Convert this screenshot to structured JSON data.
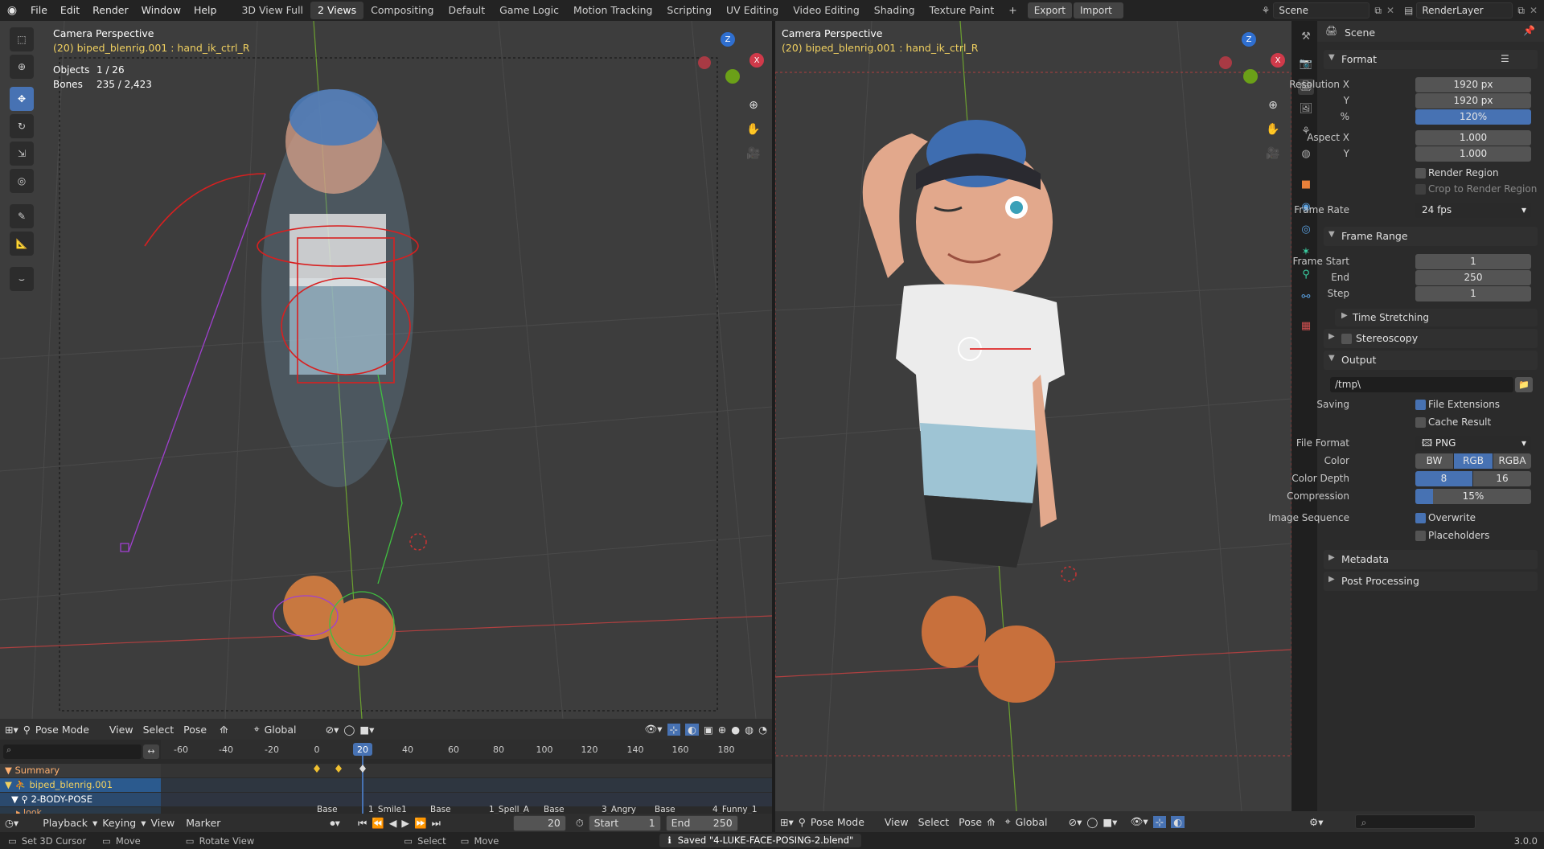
{
  "app": {
    "logo": "blender-logo-icon"
  },
  "menu": {
    "items": [
      "File",
      "Edit",
      "Render",
      "Window",
      "Help"
    ]
  },
  "workspaces": {
    "tabs": [
      "3D View Full",
      "2 Views",
      "Compositing",
      "Default",
      "Game Logic",
      "Motion Tracking",
      "Scripting",
      "UV Editing",
      "Video Editing",
      "Shading",
      "Texture Paint"
    ],
    "active": "2 Views",
    "add": "+"
  },
  "export_btn": "Export",
  "import_btn": "Import",
  "scene": {
    "name": "Scene",
    "view_layer": "RenderLayer"
  },
  "left_viewport": {
    "title": "Camera Perspective",
    "subtitle": "(20) biped_blenrig.001 : hand_ik_ctrl_R",
    "stats_objects_label": "Objects",
    "stats_objects_value": "1 / 26",
    "stats_bones_label": "Bones",
    "stats_bones_value": "235 / 2,423"
  },
  "right_viewport": {
    "title": "Camera Perspective",
    "subtitle": "(20) biped_blenrig.001 : hand_ik_ctrl_R"
  },
  "viewport_header": {
    "mode": "Pose Mode",
    "view": "View",
    "select": "Select",
    "pose": "Pose",
    "orientation": "Global"
  },
  "timeline": {
    "ruler": [
      "-60",
      "-40",
      "-20",
      "0",
      "20",
      "40",
      "60",
      "80",
      "100",
      "120",
      "140",
      "160",
      "180"
    ],
    "current_frame": "20",
    "channels": [
      "Summary",
      "biped_blenrig.001",
      "2-BODY-POSE",
      "look"
    ],
    "markers": [
      "Base",
      "1_Smile1",
      "Base",
      "1_Spell_A",
      "Base",
      "3_Angry",
      "Base",
      "4_Funny_1"
    ],
    "playback": "Playback",
    "keying": "Keying",
    "view": "View",
    "marker": "Marker",
    "frame_field": "20",
    "start_label": "Start",
    "start_value": "1",
    "end_label": "End",
    "end_value": "250"
  },
  "properties": {
    "header": "Scene",
    "sections": {
      "format": "Format",
      "frame_range": "Frame Range",
      "time_stretching": "Time Stretching",
      "stereoscopy": "Stereoscopy",
      "output": "Output",
      "metadata": "Metadata",
      "post_processing": "Post Processing"
    },
    "resolution_x_label": "Resolution X",
    "resolution_x": "1920 px",
    "resolution_y_label": "Y",
    "resolution_y": "1920 px",
    "percent_label": "%",
    "percent": "120%",
    "aspect_x_label": "Aspect X",
    "aspect_x": "1.000",
    "aspect_y_label": "Y",
    "aspect_y": "1.000",
    "render_region": "Render Region",
    "crop_region": "Crop to Render Region",
    "frame_rate_label": "Frame Rate",
    "frame_rate": "24 fps",
    "frame_start_label": "Frame Start",
    "frame_start": "1",
    "end_label": "End",
    "end": "250",
    "step_label": "Step",
    "step": "1",
    "output_path": "/tmp\\",
    "saving_label": "Saving",
    "file_extensions": "File Extensions",
    "cache_result": "Cache Result",
    "file_format_label": "File Format",
    "file_format": "PNG",
    "color_label": "Color",
    "color_bw": "BW",
    "color_rgb": "RGB",
    "color_rgba": "RGBA",
    "color_depth_label": "Color Depth",
    "depth_8": "8",
    "depth_16": "16",
    "compression_label": "Compression",
    "compression": "15%",
    "compression_fraction": 0.15,
    "image_sequence_label": "Image Sequence",
    "overwrite": "Overwrite",
    "placeholders": "Placeholders"
  },
  "status": {
    "set_cursor": "Set 3D Cursor",
    "move": "Move",
    "rotate": "Rotate View",
    "select": "Select",
    "move2": "Move",
    "message": "Saved \"4-LUKE-FACE-POSING-2.blend\"",
    "version": "3.0.0"
  },
  "colors": {
    "accent": "#4772b3",
    "viewport_bg": "#3d3d3d",
    "panel_bg": "#2b2b2b"
  }
}
